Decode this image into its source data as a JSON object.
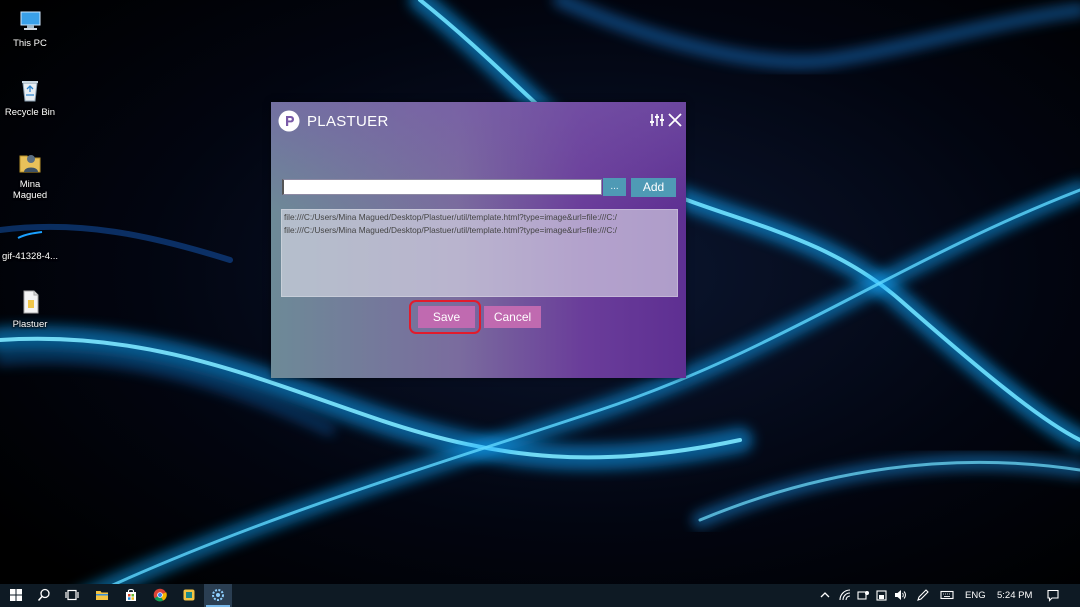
{
  "desktop": {
    "icons": [
      {
        "label": "This PC"
      },
      {
        "label": "Recycle Bin"
      },
      {
        "label": "Mina Magued"
      },
      {
        "label": "gif-41328-4..."
      },
      {
        "label": "Plastuer"
      }
    ]
  },
  "dialog": {
    "title": "PLASTUER",
    "url_input": {
      "value": "",
      "placeholder": ""
    },
    "browse_label": "...",
    "add_label": "Add",
    "urls": [
      "file:///C:/Users/Mina Magued/Desktop/Plastuer/util/template.html?type=image&url=file:///C:/",
      "file:///C:/Users/Mina Magued/Desktop/Plastuer/util/template.html?type=image&url=file:///C:/"
    ],
    "save_label": "Save",
    "cancel_label": "Cancel"
  },
  "taskbar": {
    "language": "ENG",
    "time": "5:24 PM"
  },
  "colors": {
    "accent_button": "#4f9ab5",
    "action_button": "#c06ab0",
    "highlight": "#e21b2c",
    "taskbar": "#0e1a24"
  }
}
